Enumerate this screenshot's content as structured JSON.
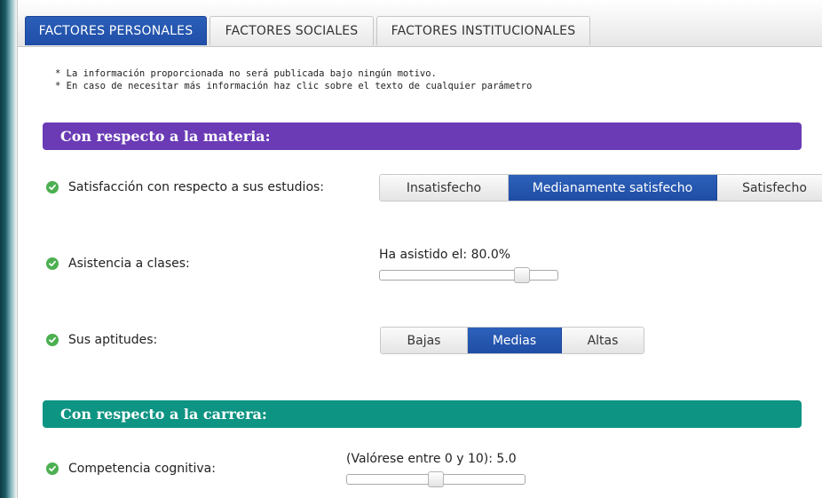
{
  "tabs": [
    {
      "label": "FACTORES PERSONALES",
      "active": true
    },
    {
      "label": "FACTORES SOCIALES",
      "active": false
    },
    {
      "label": "FACTORES INSTITUCIONALES",
      "active": false
    }
  ],
  "notes": [
    "* La información proporcionada no será publicada bajo ningún motivo.",
    "* En caso de necesitar más información haz clic sobre el texto de cualquier parámetro"
  ],
  "sections": [
    {
      "title": "Con respecto a la materia:",
      "color": "#6a3bb5"
    },
    {
      "title": "Con respecto a la carrera:",
      "color": "#0e9483"
    }
  ],
  "fields": {
    "satisfaccion": {
      "label": "Satisfacción con respecto a sus estudios:",
      "options": [
        "Insatisfecho",
        "Medianamente satisfecho",
        "Satisfecho"
      ],
      "selected": "Medianamente satisfecho"
    },
    "asistencia": {
      "label": "Asistencia a clases:",
      "value_text": "Ha asistido el: 80.0%",
      "value_fraction": 0.8
    },
    "aptitudes": {
      "label": "Sus aptitudes:",
      "options": [
        "Bajas",
        "Medias",
        "Altas"
      ],
      "selected": "Medias"
    },
    "competencia": {
      "label": "Competencia cognitiva:",
      "value_text": "(Valórese entre 0 y 10): 5.0",
      "value_fraction": 0.5
    }
  },
  "icons": {
    "status": "check-circle-icon",
    "status_color": "#4caf50"
  }
}
